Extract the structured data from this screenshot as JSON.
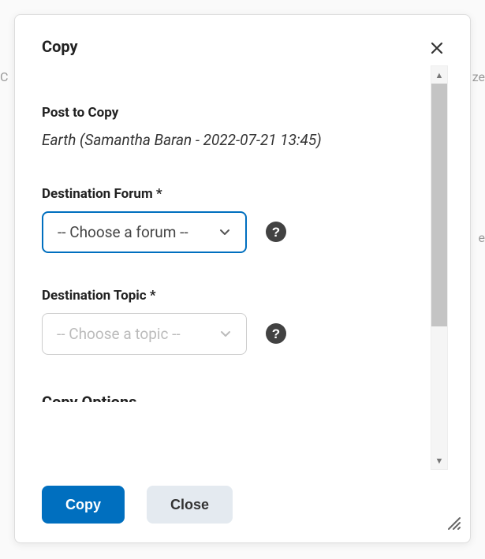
{
  "backdrop": {
    "left": "C",
    "right1": "ze",
    "right2": "e"
  },
  "dialog": {
    "title": "Copy"
  },
  "post": {
    "label": "Post to Copy",
    "value": "Earth (Samantha Baran - 2022-07-21 13:45)"
  },
  "forum": {
    "label": "Destination Forum *",
    "selected": "-- Choose a forum --"
  },
  "topic": {
    "label": "Destination Topic *",
    "selected": "-- Choose a topic --"
  },
  "help": "?",
  "cutoff": "Copy Options",
  "footer": {
    "copy": "Copy",
    "close": "Close"
  }
}
